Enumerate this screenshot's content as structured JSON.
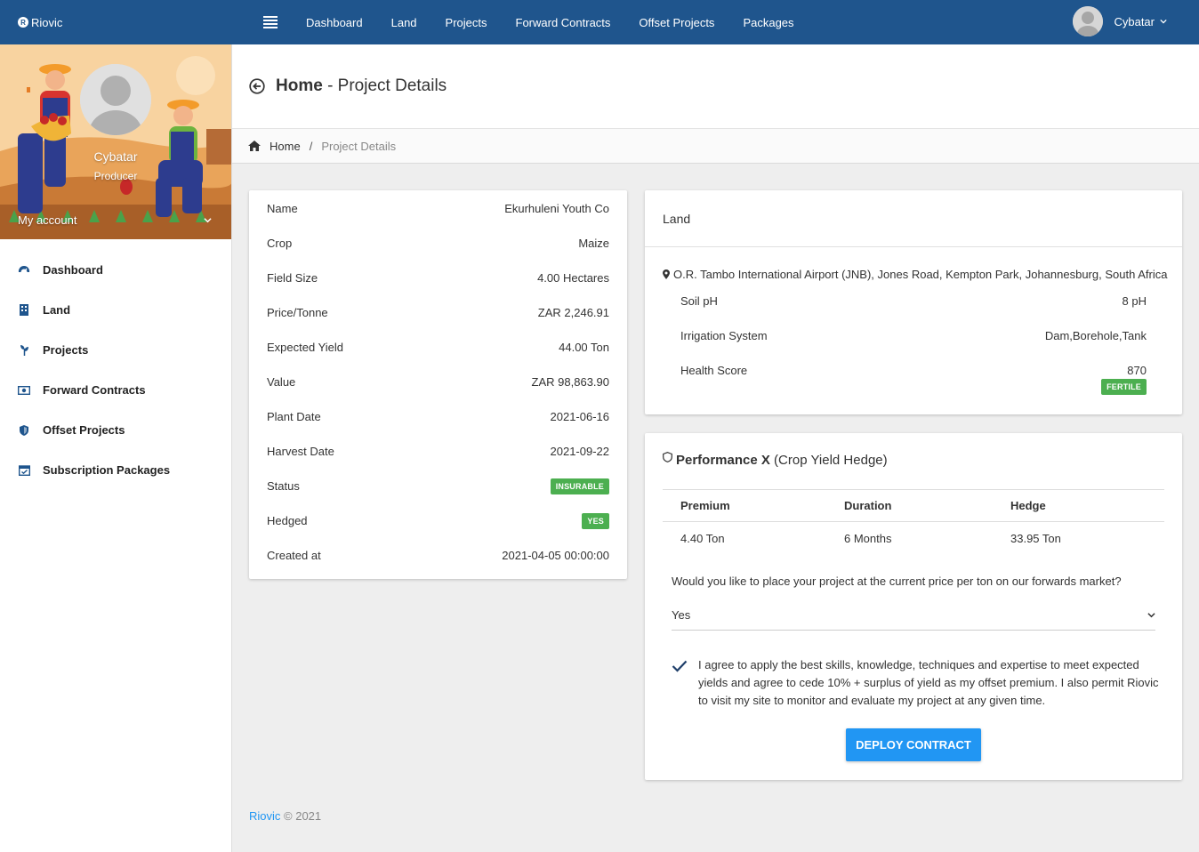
{
  "topbar": {
    "logo_text": "Riovic",
    "nav": [
      "Dashboard",
      "Land",
      "Projects",
      "Forward Contracts",
      "Offset Projects",
      "Packages"
    ],
    "user_name": "Cybatar",
    "bg_color": "#1f558d"
  },
  "sidebar": {
    "user_name": "Cybatar",
    "user_role": "Producer",
    "my_account_label": "My account",
    "items": [
      {
        "label": "Dashboard",
        "icon": "dashboard-icon"
      },
      {
        "label": "Land",
        "icon": "building-icon"
      },
      {
        "label": "Projects",
        "icon": "seedling-icon"
      },
      {
        "label": "Forward Contracts",
        "icon": "money-icon"
      },
      {
        "label": "Offset Projects",
        "icon": "shield-icon"
      },
      {
        "label": "Subscription Packages",
        "icon": "calendar-check-icon"
      }
    ]
  },
  "header": {
    "title_bold": "Home",
    "title_rest": " - Project Details"
  },
  "breadcrumb": {
    "home": "Home",
    "separator": "/",
    "current": "Project Details"
  },
  "details": {
    "rows": [
      {
        "label": "Name",
        "value": "Ekurhuleni Youth Co"
      },
      {
        "label": "Crop",
        "value": "Maize"
      },
      {
        "label": "Field Size",
        "value": "4.00 Hectares"
      },
      {
        "label": "Price/Tonne",
        "value": "ZAR 2,246.91"
      },
      {
        "label": "Expected Yield",
        "value": "44.00 Ton"
      },
      {
        "label": "Value",
        "value": "ZAR 98,863.90"
      },
      {
        "label": "Plant Date",
        "value": "2021-06-16"
      },
      {
        "label": "Harvest Date",
        "value": "2021-09-22"
      },
      {
        "label": "Status",
        "badge": "INSURABLE"
      },
      {
        "label": "Hedged",
        "badge": "YES"
      },
      {
        "label": "Created at",
        "value": "2021-04-05 00:00:00"
      }
    ]
  },
  "land": {
    "title": "Land",
    "location": "O.R. Tambo International Airport (JNB), Jones Road, Kempton Park, Johannesburg, South Africa",
    "rows": [
      {
        "label": "Soil pH",
        "value": "8 pH"
      },
      {
        "label": "Irrigation System",
        "value": "Dam,Borehole,Tank"
      },
      {
        "label": "Health Score",
        "value": "870"
      }
    ],
    "health_badge": "FERTILE"
  },
  "performance": {
    "title_bold": "Performance X",
    "title_rest": " (Crop Yield Hedge)",
    "columns": [
      "Premium",
      "Duration",
      "Hedge"
    ],
    "values": [
      "4.40 Ton",
      "6 Months",
      "33.95 Ton"
    ],
    "question": "Would you like to place your project at the current price per ton on our forwards market?",
    "select_value": "Yes",
    "agreement": "I agree to apply the best skills, knowledge, techniques and expertise to meet expected yields and agree to cede 10% + surplus of yield as my offset premium. I also permit Riovic to visit my site to monitor and evaluate my project at any given time.",
    "deploy_label": "DEPLOY CONTRACT"
  },
  "footer": {
    "brand": "Riovic",
    "copyright": " © 2021"
  },
  "colors": {
    "accent": "#2196f3",
    "badge_green": "#4caf50"
  }
}
